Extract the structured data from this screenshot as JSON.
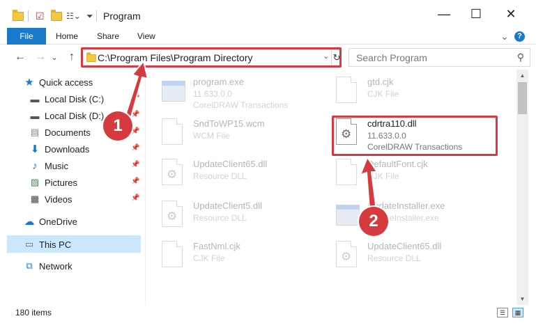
{
  "window": {
    "title": "Program",
    "minimize_glyph": "—",
    "maximize_glyph": "☐",
    "close_glyph": "✕"
  },
  "ribbon": {
    "file_label": "File",
    "tabs": [
      {
        "label": "Home"
      },
      {
        "label": "Share"
      },
      {
        "label": "View"
      }
    ],
    "expand_glyph": "⌄",
    "help_glyph": "?"
  },
  "nav": {
    "back_glyph": "←",
    "forward_glyph": "→",
    "recent_glyph": "⌄",
    "up_glyph": "↑",
    "address": "C:\\Program Files\\Program Directory",
    "search_placeholder": "Search Program"
  },
  "sidebar": {
    "quick_access": "Quick access",
    "items": [
      {
        "label": "Local Disk (C:)",
        "icon": "drive-icon"
      },
      {
        "label": "Local Disk (D:)",
        "icon": "drive-icon"
      },
      {
        "label": "Documents",
        "icon": "documents-icon"
      },
      {
        "label": "Downloads",
        "icon": "downloads-icon"
      },
      {
        "label": "Music",
        "icon": "music-icon"
      },
      {
        "label": "Pictures",
        "icon": "pictures-icon"
      },
      {
        "label": "Videos",
        "icon": "videos-icon"
      }
    ],
    "onedrive": "OneDrive",
    "this_pc": "This PC",
    "network": "Network"
  },
  "files": [
    {
      "name": "program.exe",
      "line2": "11.633.0.0",
      "line3": "CorelDRAW Transactions",
      "icon": "exe-icon"
    },
    {
      "name": "gtd.cjk",
      "line2": "CJK File",
      "line3": "",
      "icon": "document-icon"
    },
    {
      "name": "SndToWP15.wcm",
      "line2": "WCM File",
      "line3": "",
      "icon": "document-icon"
    },
    {
      "name": "cdrtra110.dll",
      "line2": "11.633.0.0",
      "line3": "CorelDRAW Transactions",
      "icon": "dll-icon"
    },
    {
      "name": "UpdateClient65.dll",
      "line2": "Resource DLL",
      "line3": "",
      "icon": "dll-icon"
    },
    {
      "name": "DefaultFont.cjk",
      "line2": "CJK File",
      "line3": "",
      "icon": "document-icon"
    },
    {
      "name": "UpdateClient5.dll",
      "line2": "Resource DLL",
      "line3": "",
      "icon": "dll-icon"
    },
    {
      "name": "UpdateInstaller.exe",
      "line2": "UpdateInstaller.exe",
      "line3": "",
      "icon": "exe-icon"
    },
    {
      "name": "FastNml.cjk",
      "line2": "CJK File",
      "line3": "",
      "icon": "document-icon"
    },
    {
      "name": "UpdateClient65.dll",
      "line2": "Resource DLL",
      "line3": "",
      "icon": "dll-icon"
    }
  ],
  "status": {
    "count": "180 items"
  },
  "callouts": {
    "step1": "1",
    "step2": "2"
  },
  "colors": {
    "accent": "#1979ca",
    "highlight": "#d63a3e",
    "selection": "#cce8ff"
  }
}
